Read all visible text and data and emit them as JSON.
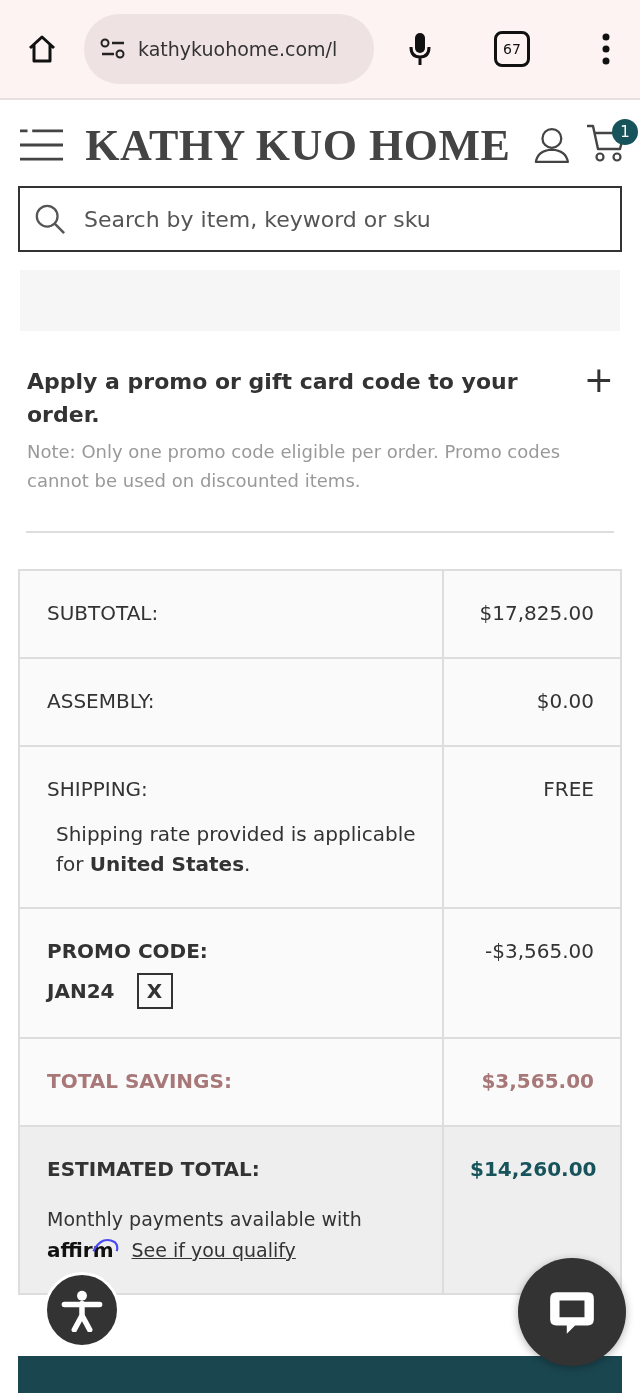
{
  "browser": {
    "url": "kathykuohome.com/l",
    "tab_count": "67"
  },
  "header": {
    "logo": "KATHY KUO HOME",
    "cart_count": "1"
  },
  "search": {
    "placeholder": "Search by item, keyword or sku"
  },
  "promo": {
    "title": "Apply a promo or gift card code to your order.",
    "expand_icon": "+",
    "note": "Note: Only one promo code eligible per order. Promo codes cannot be used on discounted items."
  },
  "summary": [
    {
      "kind": "plain",
      "label": "SUBTOTAL:",
      "value": "$17,825.00"
    },
    {
      "kind": "plain",
      "label": "ASSEMBLY:",
      "value": "$0.00"
    },
    {
      "kind": "shipping",
      "label": "SHIPPING:",
      "value": "FREE",
      "note": "Shipping rate provided is applicable for **United States**."
    },
    {
      "kind": "promo",
      "label": "PROMO CODE:",
      "value": "-$3,565.00",
      "code": "JAN24",
      "remove": "X"
    },
    {
      "kind": "savings",
      "label": "TOTAL SAVINGS:",
      "value": "$3,565.00"
    },
    {
      "kind": "total",
      "label": "ESTIMATED TOTAL:",
      "value": "$14,260.00",
      "financing": "Monthly payments available with",
      "lender": "affirm",
      "link": "See if you qualify"
    }
  ]
}
